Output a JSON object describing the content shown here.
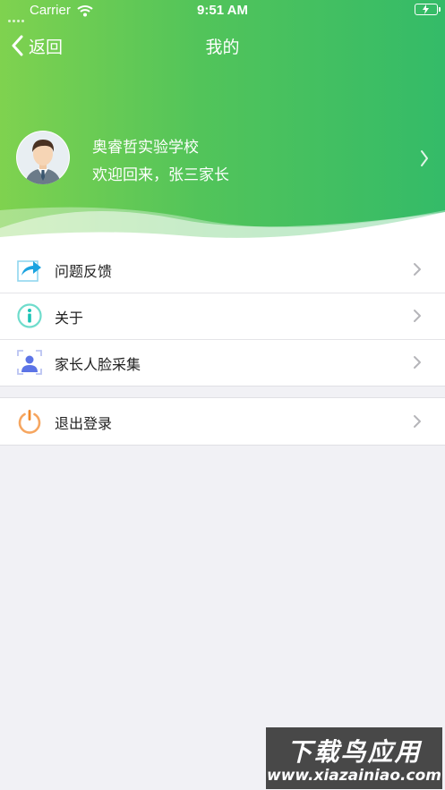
{
  "status_bar": {
    "carrier": "Carrier",
    "time": "9:51 AM"
  },
  "nav": {
    "back_label": "返回",
    "title": "我的"
  },
  "profile": {
    "school": "奥睿哲实验学校",
    "welcome": "欢迎回来，张三家长"
  },
  "menu": [
    {
      "label": "问题反馈",
      "icon": "feedback-share-icon"
    },
    {
      "label": "关于",
      "icon": "info-icon"
    },
    {
      "label": "家长人脸采集",
      "icon": "face-capture-icon"
    }
  ],
  "logout": {
    "label": "退出登录",
    "icon": "power-icon"
  },
  "watermark": {
    "title": "下载鸟应用",
    "url": "www.xiazainiao.com"
  },
  "colors": {
    "header_start": "#7fd24f",
    "header_end": "#34bb68",
    "background": "#f1f1f5"
  }
}
